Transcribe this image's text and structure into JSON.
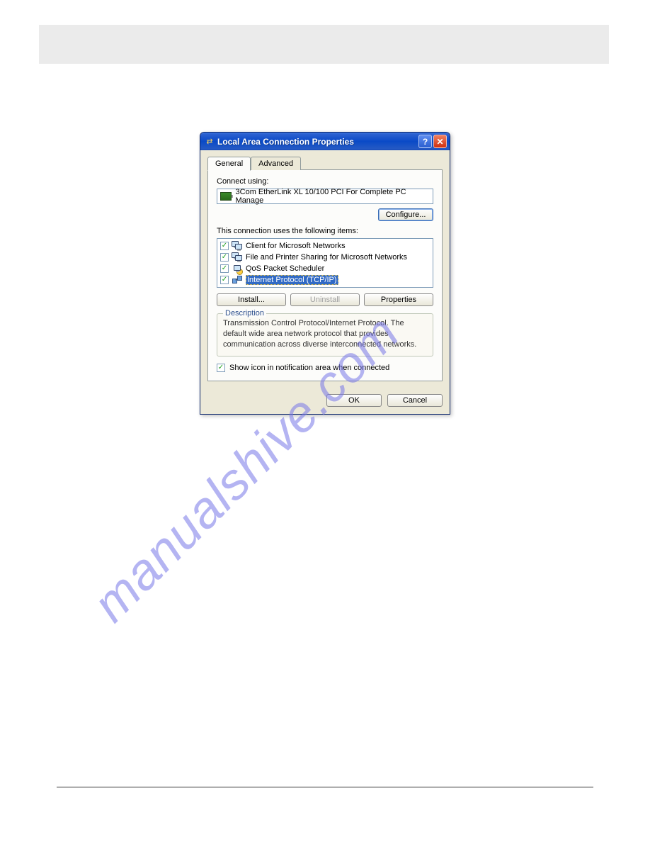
{
  "watermark": "manualshive.com",
  "dialog": {
    "title": "Local Area Connection Properties",
    "tabs": {
      "general": "General",
      "advanced": "Advanced"
    },
    "connectUsingLabel": "Connect using:",
    "adapterName": "3Com EtherLink XL 10/100 PCI For Complete PC Manage",
    "configureBtn": "Configure...",
    "itemsLabel": "This connection uses the following items:",
    "items": [
      {
        "label": "Client for Microsoft Networks",
        "checked": true,
        "iconType": "net"
      },
      {
        "label": "File and Printer Sharing for Microsoft Networks",
        "checked": true,
        "iconType": "net"
      },
      {
        "label": "QoS Packet Scheduler",
        "checked": true,
        "iconType": "qos"
      },
      {
        "label": "Internet Protocol (TCP/IP)",
        "checked": true,
        "iconType": "tcp",
        "selected": true
      }
    ],
    "buttons": {
      "install": "Install...",
      "uninstall": "Uninstall",
      "properties": "Properties"
    },
    "description": {
      "title": "Description",
      "text": "Transmission Control Protocol/Internet Protocol. The default wide area network protocol that provides communication across diverse interconnected networks."
    },
    "showIconLabel": "Show icon in notification area when connected",
    "showIconChecked": true,
    "footer": {
      "ok": "OK",
      "cancel": "Cancel"
    }
  }
}
